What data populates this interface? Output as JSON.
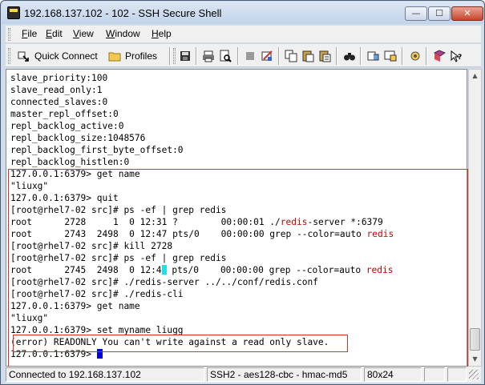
{
  "window": {
    "title": "192.168.137.102 - 102 - SSH Secure Shell",
    "buttons": {
      "minimize": "—",
      "maximize": "☐",
      "close": "✕"
    }
  },
  "menu": [
    {
      "label": "File",
      "underline": "F",
      "rest": "ile"
    },
    {
      "label": "Edit",
      "underline": "E",
      "rest": "dit"
    },
    {
      "label": "View",
      "underline": "V",
      "rest": "iew"
    },
    {
      "label": "Window",
      "underline": "W",
      "rest": "indow"
    },
    {
      "label": "Help",
      "underline": "H",
      "rest": "elp"
    }
  ],
  "toolbar": {
    "quick_connect_label": "Quick Connect",
    "profiles_label": "Profiles"
  },
  "terminal": {
    "lines": [
      "slave_priority:100",
      "slave_read_only:1",
      "connected_slaves:0",
      "master_repl_offset:0",
      "repl_backlog_active:0",
      "repl_backlog_size:1048576",
      "repl_backlog_first_byte_offset:0",
      "repl_backlog_histlen:0",
      "127.0.0.1:6379> get name",
      "\"liuxg\"",
      "127.0.0.1:6379> quit",
      "[root@rhel7-02 src]# ps -ef | grep redis",
      "root      2728     1  0 12:31 ?        00:00:01 ./|redis|-server *:6379",
      "root      2743  2498  0 12:47 pts/0    00:00:00 grep --color=auto |redis|",
      "[root@rhel7-02 src]# kill 2728",
      "[root@rhel7-02 src]# ps -ef | grep redis",
      "root      2745  2498  0 12:4",
      "[root@rhel7-02 src]# ./redis-server ../../conf/redis.conf",
      "[root@rhel7-02 src]# ./redis-cli",
      "127.0.0.1:6379> get name",
      "\"liuxg\"",
      "127.0.0.1:6379> set myname liugg",
      "(error) READONLY You can't write against a read only slave.",
      "127.0.0.1:6379> "
    ],
    "line17_pre": "root      2745  2498  0 12:4",
    "line17_post": " pts/0    00:00:00 grep --color=auto ",
    "line17_red": "redis",
    "line13_pre": "root      2728     1  0 12:31 ?        00:00:01 ./",
    "line13_red": "redis",
    "line13_post": "-server *:6379",
    "line14_pre": "root      2743  2498  0 12:47 pts/0    00:00:00 grep --color=auto ",
    "line14_red": "redis"
  },
  "status": {
    "connection": "Connected to 192.168.137.102",
    "cipher": "SSH2 - aes128-cbc - hmac-md5",
    "size": "80x24"
  },
  "colors": {
    "highlight_red": "#d9312a",
    "grep_match": "#cc0000",
    "cursor": "#0000d8"
  },
  "icons": [
    "app-icon",
    "quick-connect-icon",
    "profiles-folder-icon",
    "save-icon",
    "print-icon",
    "print-preview-icon",
    "disconnect-icon",
    "settings-icon",
    "copy-icon",
    "paste-icon",
    "paste-special-icon",
    "find-icon",
    "file-transfer-icon",
    "new-terminal-icon",
    "keygen-icon",
    "help-book-icon",
    "whats-this-icon"
  ]
}
